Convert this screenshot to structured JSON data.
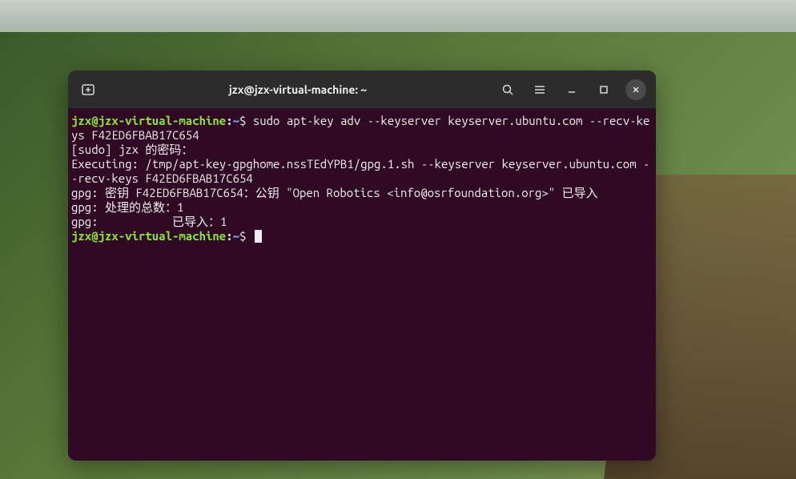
{
  "window": {
    "title": "jzx@jzx-virtual-machine: ~"
  },
  "prompt": {
    "user_host": "jzx@jzx-virtual-machine",
    "colon": ":",
    "path": "~",
    "dollar": "$"
  },
  "terminal": {
    "command1": " sudo apt-key adv --keyserver keyserver.ubuntu.com --recv-keys F42ED6FBAB17C654",
    "lines": [
      "[sudo] jzx 的密码：",
      "Executing: /tmp/apt-key-gpghome.nssTEdYPB1/gpg.1.sh --keyserver keyserver.ubuntu.com --recv-keys F42ED6FBAB17C654",
      "gpg: 密钥 F42ED6FBAB17C654：公钥 \"Open Robotics <info@osrfoundation.org>\" 已导入",
      "gpg: 处理的总数：1",
      "gpg:           已导入：1"
    ]
  }
}
